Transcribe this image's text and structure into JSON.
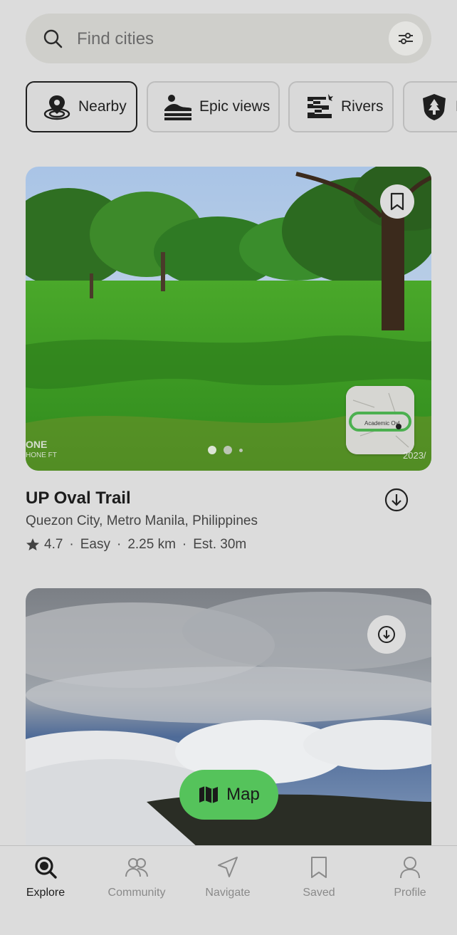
{
  "search": {
    "placeholder": "Find cities",
    "icon": "search-icon",
    "filter_icon": "sliders-icon"
  },
  "chips": [
    {
      "label": "Nearby",
      "icon": "location-pin-icon",
      "active": true
    },
    {
      "label": "Epic views",
      "icon": "mountain-view-icon",
      "active": false
    },
    {
      "label": "Rivers",
      "icon": "river-icon",
      "active": false
    },
    {
      "label": "P",
      "icon": "park-shield-icon",
      "active": false
    }
  ],
  "trail1": {
    "title": "UP Oval Trail",
    "location": "Quezon City, Metro Manila, Philippines",
    "rating": "4.7",
    "difficulty": "Easy",
    "distance": "2.25 km",
    "estimate": "Est. 30m",
    "map_label": "Academic Ovl",
    "photo_watermark": "ONE",
    "photo_watermark_sub": "HONE FT",
    "photo_date": "2023/",
    "carousel_dots": 3,
    "carousel_active": 0
  },
  "map_button": {
    "label": "Map"
  },
  "nav": [
    {
      "label": "Explore",
      "icon": "explore-search-icon",
      "active": true
    },
    {
      "label": "Community",
      "icon": "community-icon",
      "active": false
    },
    {
      "label": "Navigate",
      "icon": "navigate-arrow-icon",
      "active": false
    },
    {
      "label": "Saved",
      "icon": "bookmark-icon",
      "active": false
    },
    {
      "label": "Profile",
      "icon": "profile-icon",
      "active": false
    }
  ],
  "colors": {
    "background": "#dcdcdc",
    "accent_green": "#55c35b",
    "text": "#1f1f1f"
  }
}
